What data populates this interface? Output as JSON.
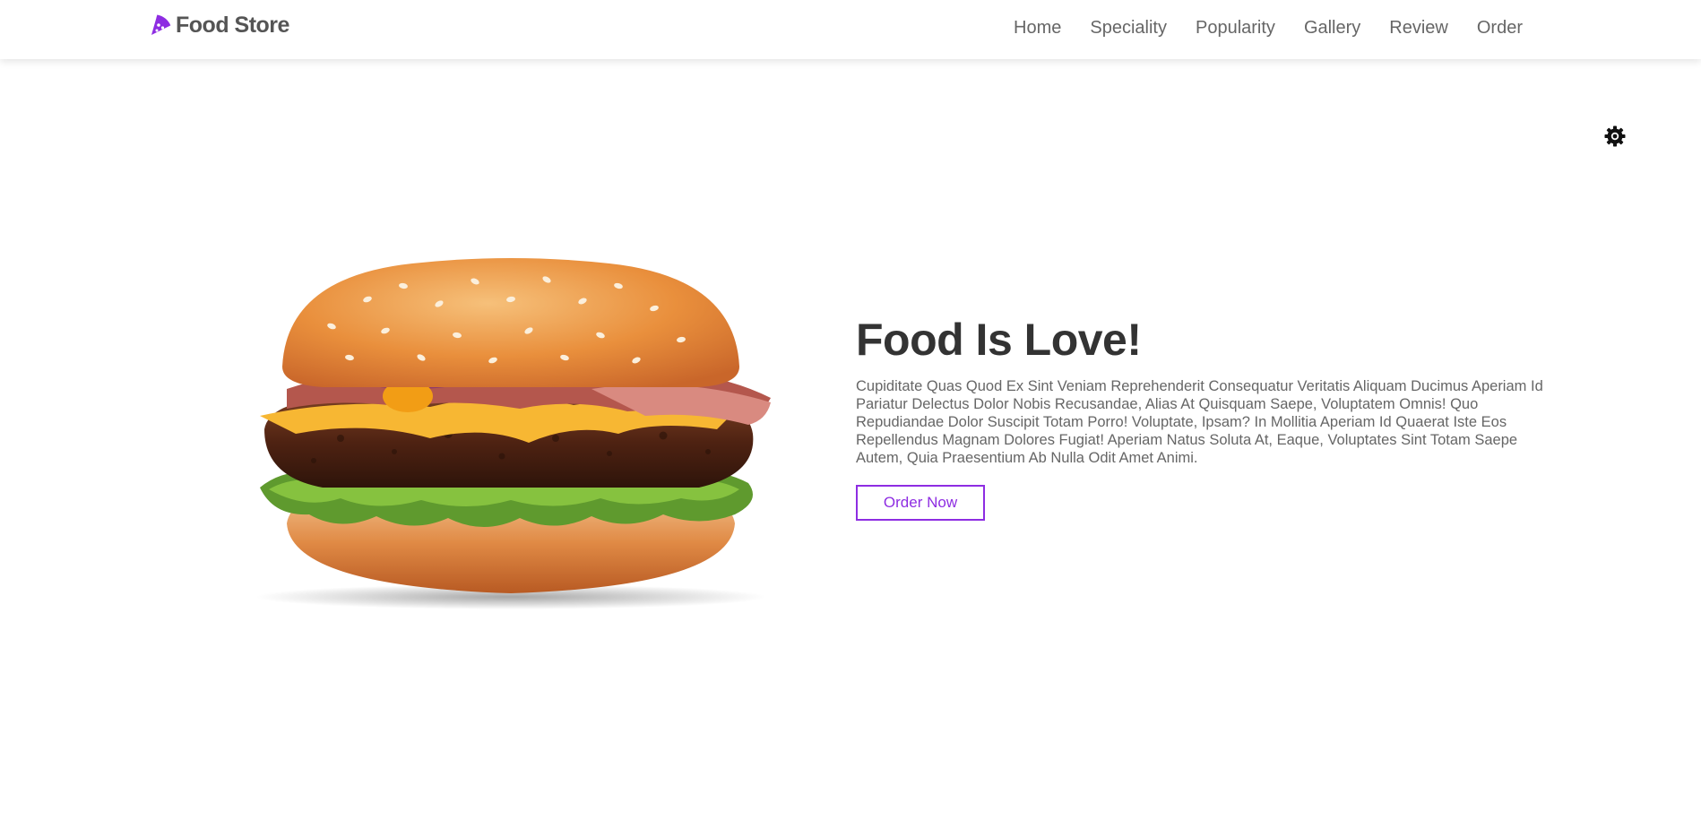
{
  "header": {
    "logo_text": "Food Store",
    "logo_icon": "pizza-slice-icon",
    "nav": [
      {
        "label": "Home"
      },
      {
        "label": "Speciality"
      },
      {
        "label": "Popularity"
      },
      {
        "label": "Gallery"
      },
      {
        "label": "Review"
      },
      {
        "label": "Order"
      }
    ]
  },
  "theme_toggle": {
    "icon": "gear-icon"
  },
  "hero": {
    "image": "burger-image",
    "title": "Food Is Love!",
    "description": "Cupiditate Quas Quod Ex Sint Veniam Reprehenderit Consequatur Veritatis Aliquam Ducimus Aperiam Id Pariatur Delectus Dolor Nobis Recusandae, Alias At Quisquam Saepe, Voluptatem Omnis! Quo Repudiandae Dolor Suscipit Totam Porro! Voluptate, Ipsam? In Mollitia Aperiam Id Quaerat Iste Eos Repellendus Magnam Dolores Fugiat! Aperiam Natus Soluta At, Eaque, Voluptates Sint Totam Saepe Autem, Quia Praesentium Ab Nulla Odit Amet Animi.",
    "button_label": "Order Now"
  },
  "colors": {
    "accent": "#8e2de2",
    "title": "#333333",
    "text": "#666666"
  }
}
